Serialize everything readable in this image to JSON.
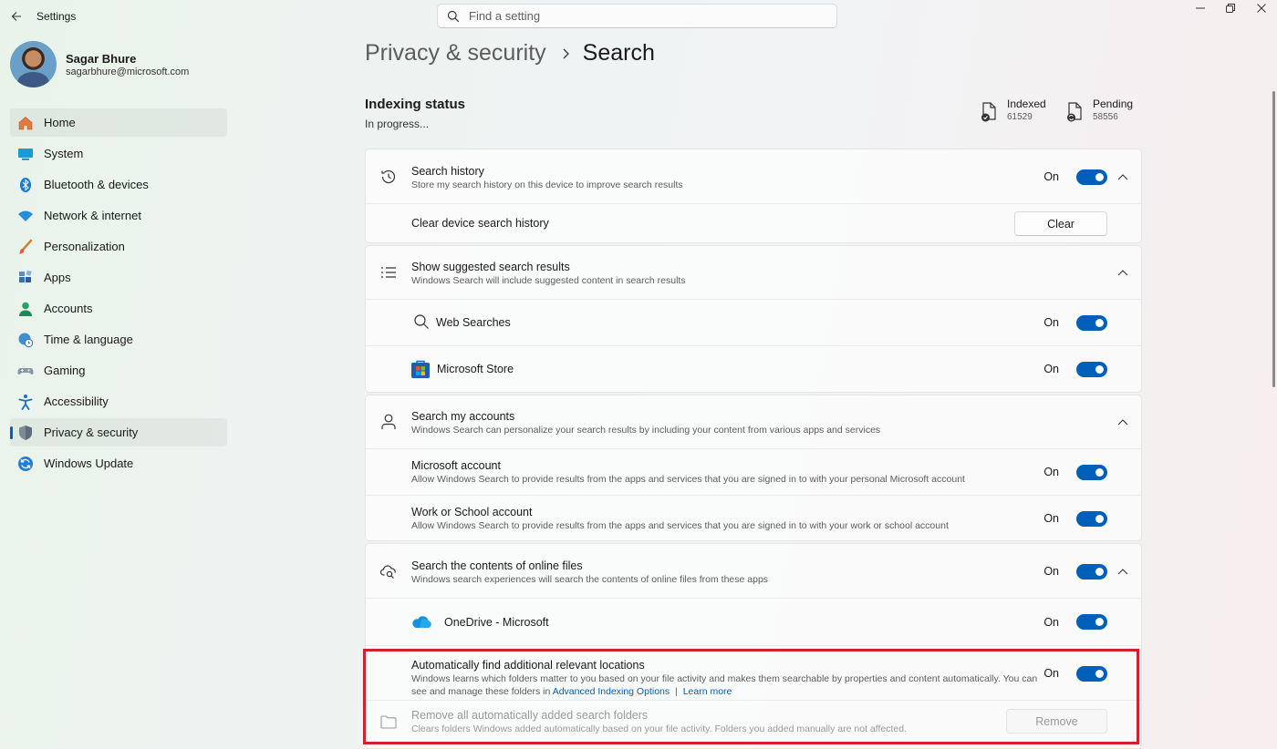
{
  "app": {
    "title": "Settings"
  },
  "search": {
    "placeholder": "Find a setting"
  },
  "user": {
    "name": "Sagar Bhure",
    "email": "sagarbhure@microsoft.com"
  },
  "nav": {
    "items": [
      {
        "label": "Home",
        "icon": "home-icon"
      },
      {
        "label": "System",
        "icon": "monitor-icon"
      },
      {
        "label": "Bluetooth & devices",
        "icon": "bluetooth-icon"
      },
      {
        "label": "Network & internet",
        "icon": "wifi-icon"
      },
      {
        "label": "Personalization",
        "icon": "brush-icon"
      },
      {
        "label": "Apps",
        "icon": "apps-icon"
      },
      {
        "label": "Accounts",
        "icon": "person-icon"
      },
      {
        "label": "Time & language",
        "icon": "globe-clock-icon"
      },
      {
        "label": "Gaming",
        "icon": "controller-icon"
      },
      {
        "label": "Accessibility",
        "icon": "accessibility-icon"
      },
      {
        "label": "Privacy & security",
        "icon": "shield-icon"
      },
      {
        "label": "Windows Update",
        "icon": "update-icon"
      }
    ]
  },
  "breadcrumb": {
    "parent": "Privacy & security",
    "current": "Search"
  },
  "indexing": {
    "title": "Indexing status",
    "status": "In progress...",
    "indexed_label": "Indexed",
    "indexed_value": "61529",
    "pending_label": "Pending",
    "pending_value": "58556"
  },
  "history": {
    "title": "Search history",
    "desc": "Store my search history on this device to improve search results",
    "state": "On",
    "clear_title": "Clear device search history",
    "clear_button": "Clear"
  },
  "suggested": {
    "title": "Show suggested search results",
    "desc": "Windows Search will include suggested content in search results",
    "web_title": "Web Searches",
    "web_state": "On",
    "store_title": "Microsoft Store",
    "store_state": "On"
  },
  "accounts": {
    "title": "Search my accounts",
    "desc": "Windows Search can personalize your search results by including your content from various apps and services",
    "ms_title": "Microsoft account",
    "ms_desc": "Allow Windows Search to provide results from the apps and services that you are signed in to with your personal Microsoft account",
    "ms_state": "On",
    "work_title": "Work or School account",
    "work_desc": "Allow Windows Search to provide results from the apps and services that you are signed in to with your work or school account",
    "work_state": "On"
  },
  "online": {
    "title": "Search the contents of online files",
    "desc": "Windows search experiences will search the contents of online files from these apps",
    "state": "On",
    "onedrive_title": "OneDrive - Microsoft",
    "onedrive_state": "On"
  },
  "auto": {
    "title": "Automatically find additional relevant locations",
    "desc_line1": "Windows learns which folders matter to you based on your file activity and makes them searchable by properties and content automatically. You can",
    "desc_line2_prefix": "see and manage these folders in",
    "link_advanced": "Advanced Indexing Options",
    "separator": "|",
    "link_learn": "Learn more",
    "state": "On",
    "remove_title": "Remove all automatically added search folders",
    "remove_desc": "Clears folders Windows added automatically based on your file activity. Folders you added manually are not affected.",
    "remove_button": "Remove"
  },
  "colors": {
    "accent": "#005fb8",
    "highlight": "#d4202a"
  }
}
